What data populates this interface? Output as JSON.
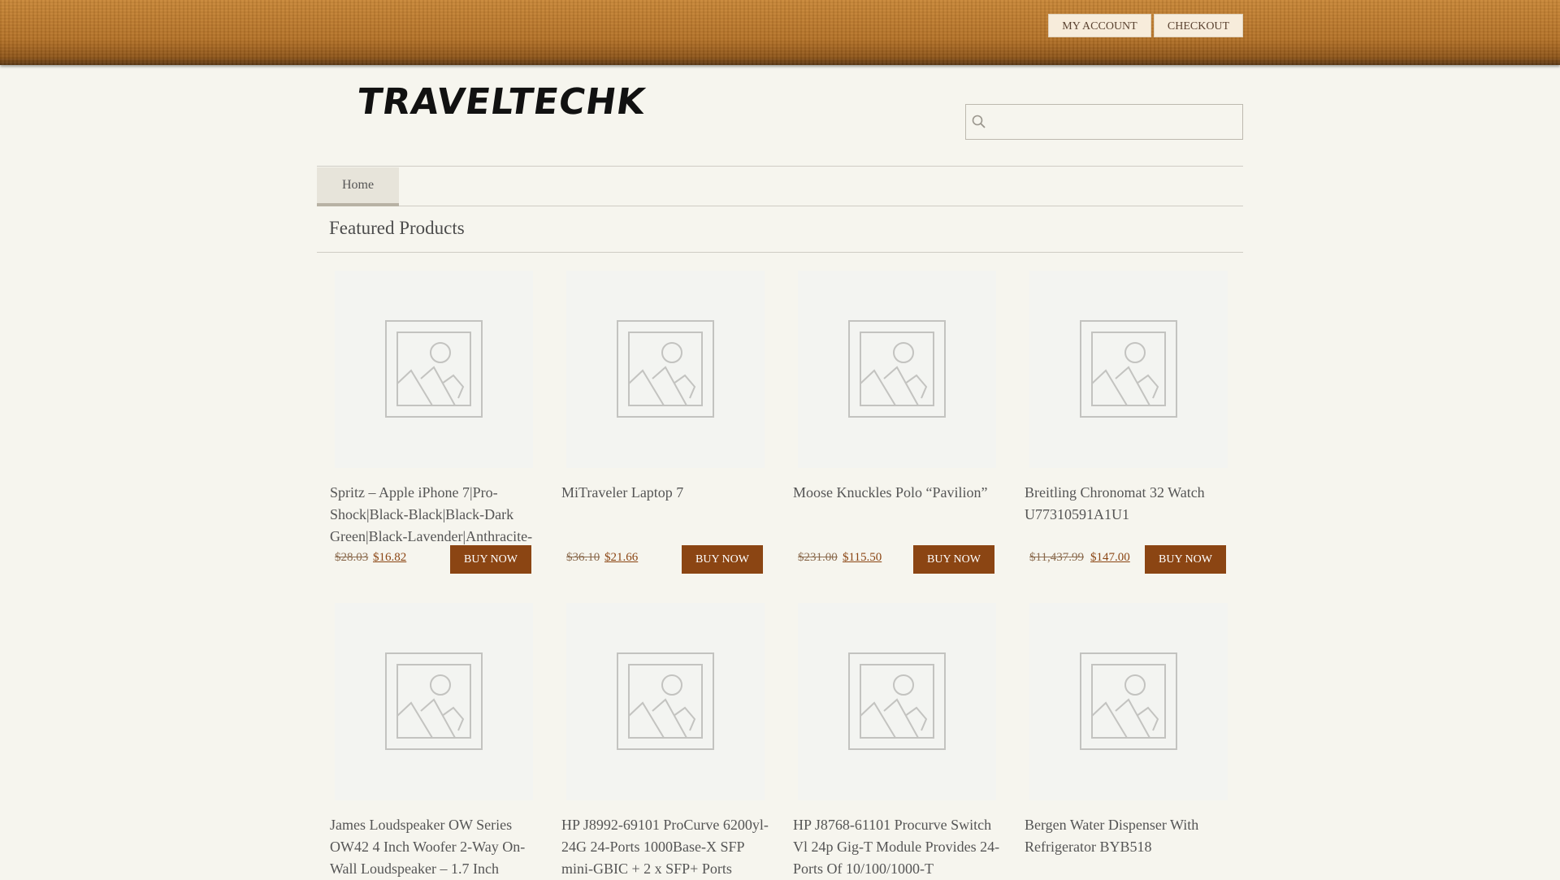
{
  "header": {
    "my_account": "MY ACCOUNT",
    "checkout": "CHECKOUT"
  },
  "logo": {
    "text": "TRAVELTECHK"
  },
  "search": {
    "placeholder": ""
  },
  "nav": {
    "home": "Home"
  },
  "section": {
    "title": "Featured Products"
  },
  "colors": {
    "accent": "#8b4513",
    "header_brown": "#b57227",
    "background": "#f6f5ee"
  },
  "products": [
    {
      "title": "Spritz – Apple iPhone 7|Pro-Shock|Black-Black|Black-Dark Green|Black-Lavender|Anthracite-",
      "old_price": "$28.03",
      "new_price": "$16.82",
      "button": "BUY NOW"
    },
    {
      "title": "MiTraveler Laptop 7",
      "old_price": "$36.10",
      "new_price": "$21.66",
      "button": "BUY NOW"
    },
    {
      "title": "Moose Knuckles Polo “Pavilion”",
      "old_price": "$231.00",
      "new_price": "$115.50",
      "button": "BUY NOW"
    },
    {
      "title": "Breitling Chronomat 32 Watch U77310591A1U1",
      "old_price": "$11,437.99",
      "new_price": "$147.00",
      "button": "BUY NOW"
    },
    {
      "title": "James Loudspeaker OW Series OW42 4 Inch Woofer 2-Way On-Wall Loudspeaker – 1.7 Inch",
      "old_price": "",
      "new_price": "",
      "button": ""
    },
    {
      "title": "HP J8992-69101 ProCurve 6200yl-24G 24-Ports 1000Base-X SFP mini-GBIC + 2 x SFP+ Ports",
      "old_price": "",
      "new_price": "",
      "button": ""
    },
    {
      "title": "HP J8768-61101 Procurve Switch Vl 24p Gig-T Module Provides 24-Ports Of 10/100/1000-T",
      "old_price": "",
      "new_price": "",
      "button": ""
    },
    {
      "title": "Bergen Water Dispenser With Refrigerator BYB518",
      "old_price": "",
      "new_price": "",
      "button": ""
    }
  ]
}
